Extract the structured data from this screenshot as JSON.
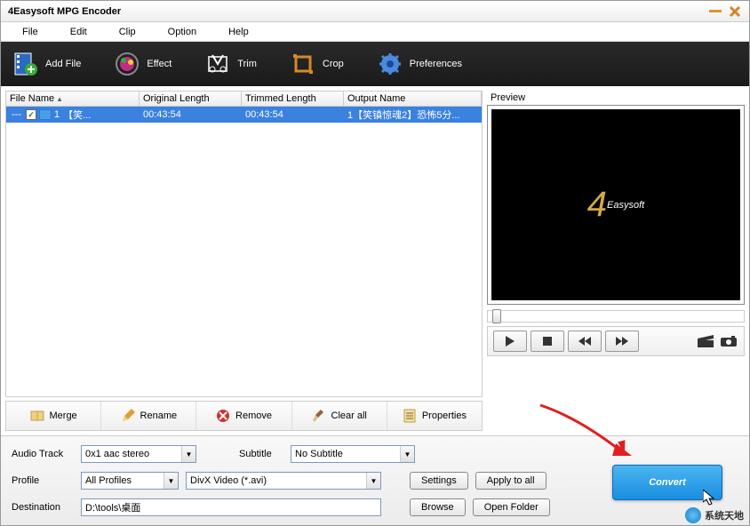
{
  "title": "4Easysoft MPG Encoder",
  "menu": {
    "file": "File",
    "edit": "Edit",
    "clip": "Clip",
    "option": "Option",
    "help": "Help"
  },
  "toolbar": {
    "addfile": "Add File",
    "effect": "Effect",
    "trim": "Trim",
    "crop": "Crop",
    "preferences": "Preferences"
  },
  "columns": {
    "filename": "File Name",
    "origlen": "Original Length",
    "trimlen": "Trimmed Length",
    "outname": "Output Name"
  },
  "rows": [
    {
      "checked": true,
      "idx": "1",
      "name": "【笑...",
      "orig": "00:43:54",
      "trim": "00:43:54",
      "out": "1【笑镇惊魂2】恐怖5分..."
    }
  ],
  "filebtns": {
    "merge": "Merge",
    "rename": "Rename",
    "remove": "Remove",
    "clearall": "Clear all",
    "properties": "Properties"
  },
  "preview": {
    "label": "Preview",
    "logo": "Easysoft"
  },
  "bottom": {
    "audiotrack_lbl": "Audio Track",
    "audiotrack_val": "0x1 aac stereo",
    "subtitle_lbl": "Subtitle",
    "subtitle_val": "No Subtitle",
    "profile_lbl": "Profile",
    "profile_cat": "All Profiles",
    "profile_val": "DivX Video (*.avi)",
    "settings": "Settings",
    "applyall": "Apply to all",
    "dest_lbl": "Destination",
    "dest_val": "D:\\tools\\桌面",
    "browse": "Browse",
    "openfolder": "Open Folder",
    "convert": "Convert"
  },
  "watermark": "系统天地"
}
